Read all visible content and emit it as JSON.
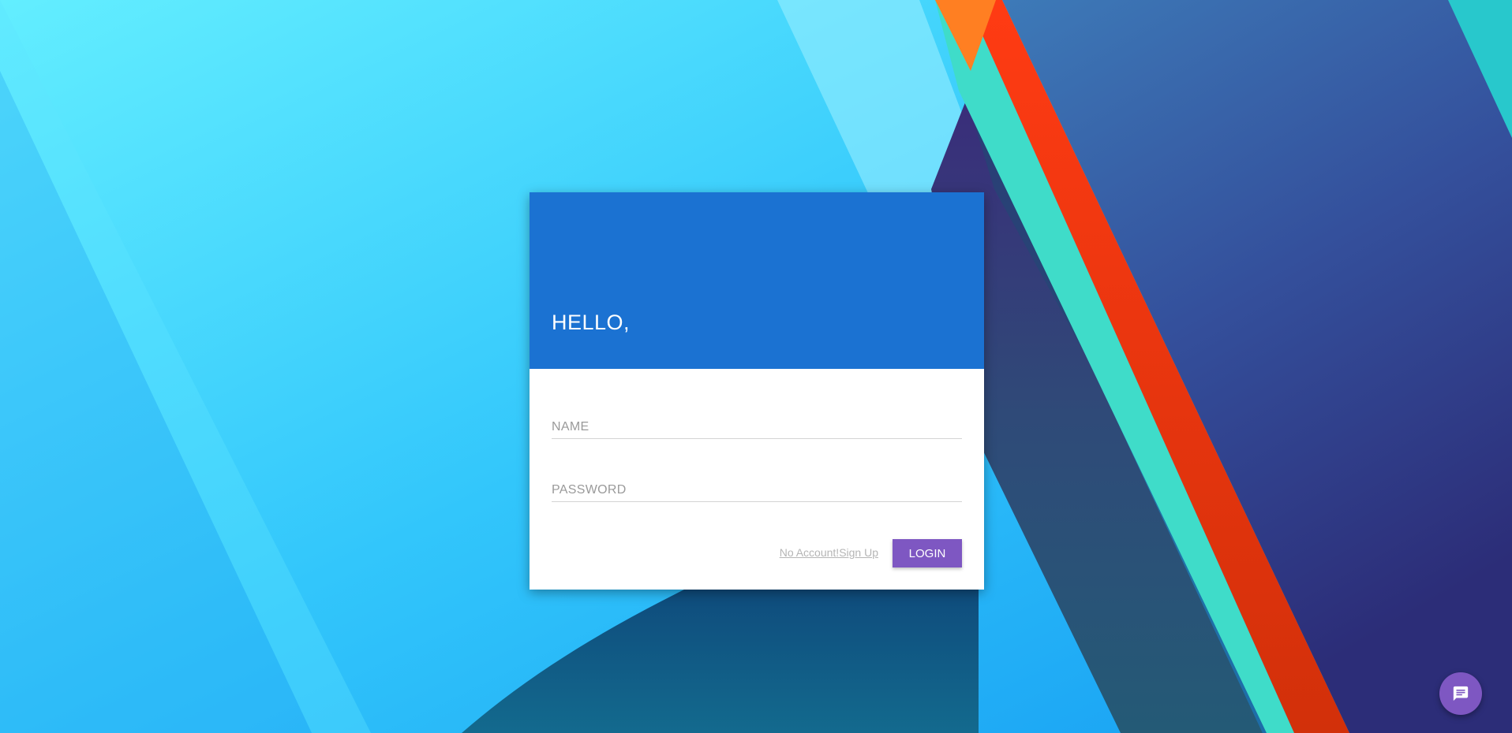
{
  "login_card": {
    "title": "HELLO,",
    "name_placeholder": "NAME",
    "password_placeholder": "PASSWORD",
    "signup_link": "No Account!Sign Up",
    "login_button": "LOGIN"
  },
  "chat_button": {
    "icon": "chat-message-icon"
  },
  "colors": {
    "header": "#1b72d2",
    "accent": "#7e57c2",
    "background_cyan": "#3fd0ff",
    "background_navy": "#2d3a8c",
    "stripe_red": "#e8380f",
    "stripe_teal": "#3fd8c8"
  }
}
